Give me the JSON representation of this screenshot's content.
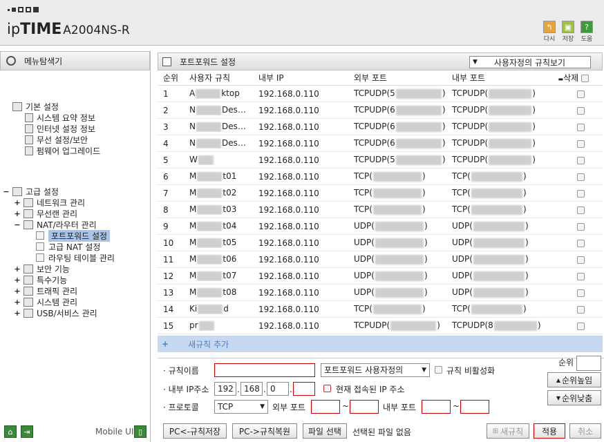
{
  "header": {
    "logo_text_ip": "ip",
    "logo_text_time": "TIME",
    "model": "A2004NS-R",
    "buttons": [
      {
        "label": "다시",
        "icon": "undo-icon",
        "color": "#e8a33a"
      },
      {
        "label": "저장",
        "icon": "save-icon",
        "color": "#9cc23e"
      },
      {
        "label": "도움",
        "icon": "help-icon",
        "color": "#3e9a3a"
      }
    ]
  },
  "sidebar": {
    "title": "메뉴탐색기",
    "groups": [
      {
        "label": "기본 설정",
        "toggle": "",
        "items": [
          {
            "label": "시스템 요약 정보"
          },
          {
            "label": "인터넷 설정 정보"
          },
          {
            "label": "무선 설정/보안"
          },
          {
            "label": "펌웨어 업그레이드"
          }
        ]
      },
      {
        "label": "고급 설정",
        "toggle": "−",
        "items": [
          {
            "label": "네트워크 관리",
            "toggle": "+"
          },
          {
            "label": "무선랜 관리",
            "toggle": "+"
          },
          {
            "label": "NAT/라우터 관리",
            "toggle": "−"
          },
          {
            "label": "포트포워드 설정",
            "sub": true,
            "selected": true
          },
          {
            "label": "고급 NAT 설정",
            "sub": true
          },
          {
            "label": "라우팅 테이블 관리",
            "sub": true
          },
          {
            "label": "보안 기능",
            "toggle": "+"
          },
          {
            "label": "특수기능",
            "toggle": "+"
          },
          {
            "label": "트래픽 관리",
            "toggle": "+"
          },
          {
            "label": "시스템 관리",
            "toggle": "+"
          },
          {
            "label": "USB/서비스 관리",
            "toggle": "+"
          }
        ]
      }
    ],
    "mobile_label": "Mobile UI"
  },
  "panel": {
    "title": "포트포워드 설정",
    "rule_view": "사용자정의 규칙보기",
    "columns": [
      "순위",
      "사용자 규칙",
      "내부 IP",
      "외부 포트",
      "내부 포트",
      "삭제"
    ],
    "rows": [
      {
        "n": "1",
        "name": "A",
        "name2": "ktop",
        "ip": "192.168.0.110",
        "ext": "TCPUDP(5",
        "int": "TCPUDP("
      },
      {
        "n": "2",
        "name": "N",
        "name2": "Des…",
        "ip": "192.168.0.110",
        "ext": "TCPUDP(6",
        "int": "TCPUDP("
      },
      {
        "n": "3",
        "name": "N",
        "name2": "Des…",
        "ip": "192.168.0.110",
        "ext": "TCPUDP(6",
        "int": "TCPUDP("
      },
      {
        "n": "4",
        "name": "N",
        "name2": "Des…",
        "ip": "192.168.0.110",
        "ext": "TCPUDP(6",
        "int": "TCPUDP("
      },
      {
        "n": "5",
        "name": "W",
        "name2": "",
        "ip": "192.168.0.110",
        "ext": "TCPUDP(5",
        "int": "TCPUDP("
      },
      {
        "n": "6",
        "name": "M",
        "name2": "t01",
        "ip": "192.168.0.110",
        "ext": "TCP(",
        "int": "TCP("
      },
      {
        "n": "7",
        "name": "M",
        "name2": "t02",
        "ip": "192.168.0.110",
        "ext": "TCP(",
        "int": "TCP("
      },
      {
        "n": "8",
        "name": "M",
        "name2": "t03",
        "ip": "192.168.0.110",
        "ext": "TCP(",
        "int": "TCP("
      },
      {
        "n": "9",
        "name": "M",
        "name2": "t04",
        "ip": "192.168.0.110",
        "ext": "UDP(",
        "int": "UDP("
      },
      {
        "n": "10",
        "name": "M",
        "name2": "t05",
        "ip": "192.168.0.110",
        "ext": "UDP(",
        "int": "UDP("
      },
      {
        "n": "11",
        "name": "M",
        "name2": "t06",
        "ip": "192.168.0.110",
        "ext": "UDP(",
        "int": "UDP("
      },
      {
        "n": "12",
        "name": "M",
        "name2": "t07",
        "ip": "192.168.0.110",
        "ext": "UDP(",
        "int": "UDP("
      },
      {
        "n": "13",
        "name": "M",
        "name2": "t08",
        "ip": "192.168.0.110",
        "ext": "UDP(",
        "int": "UDP("
      },
      {
        "n": "14",
        "name": "Ki",
        "name2": "d",
        "ip": "192.168.0.110",
        "ext": "TCP(",
        "int": "TCP("
      },
      {
        "n": "15",
        "name": "pr",
        "name2": "",
        "ip": "192.168.0.110",
        "ext": "TCPUDP(",
        "int": "TCPUDP(8"
      }
    ],
    "add_rule": "새규칙 추가"
  },
  "form": {
    "rule_name_label": "규칙이름",
    "rule_name_value": "",
    "preset": "포트포워드 사용자정의",
    "disable_label": "규칙 비활성화",
    "order_label": "순위",
    "order_value": "",
    "internal_ip_label": "내부 IP주소",
    "ip": [
      "192",
      "168",
      "0",
      ""
    ],
    "current_ip_label": "현재 접속된 IP 주소",
    "up_label": "순위높임",
    "down_label": "순위낮춤",
    "protocol_label": "프로토콜",
    "protocol": "TCP",
    "ext_port_label": "외부 포트",
    "int_port_label": "내부 포트",
    "tilde": "~"
  },
  "bottom": {
    "save_pc": "PC<-규칙저장",
    "restore_pc": "PC->규칙복원",
    "file_select": "파일 선택",
    "no_file": "선택된 파일 없음",
    "new_rule": "새규칙",
    "apply": "적용",
    "cancel": "취소"
  }
}
